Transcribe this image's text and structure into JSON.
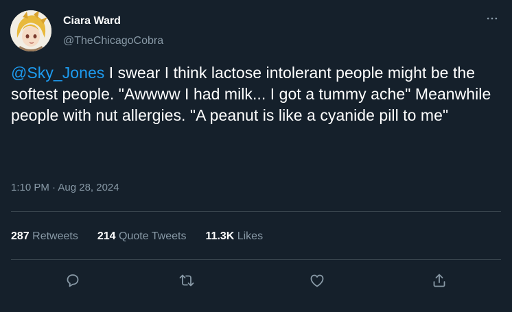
{
  "user": {
    "name": "Ciara Ward",
    "handle": "@TheChicagoCobra",
    "avatar_icon": "anime-avatar"
  },
  "tweet": {
    "mention": "@Sky_Jones",
    "text": " I swear I think lactose intolerant people might be the softest people. \"Awwww I had milk... I got a tummy ache\" Meanwhile people with nut allergies. \"A peanut is like a cyanide pill to me\"",
    "timestamp": "1:10 PM · Aug 28, 2024"
  },
  "stats": {
    "retweets_count": "287",
    "retweets_label": "Retweets",
    "quotes_count": "214",
    "quotes_label": "Quote Tweets",
    "likes_count": "11.3K",
    "likes_label": "Likes"
  },
  "icons": {
    "more": "more-icon",
    "reply": "reply-icon",
    "retweet": "retweet-icon",
    "like": "like-icon",
    "share": "share-icon"
  },
  "colors": {
    "background": "#15202b",
    "accent": "#1d9bf0",
    "secondary_text": "#8899a6",
    "divider": "#38444d"
  }
}
